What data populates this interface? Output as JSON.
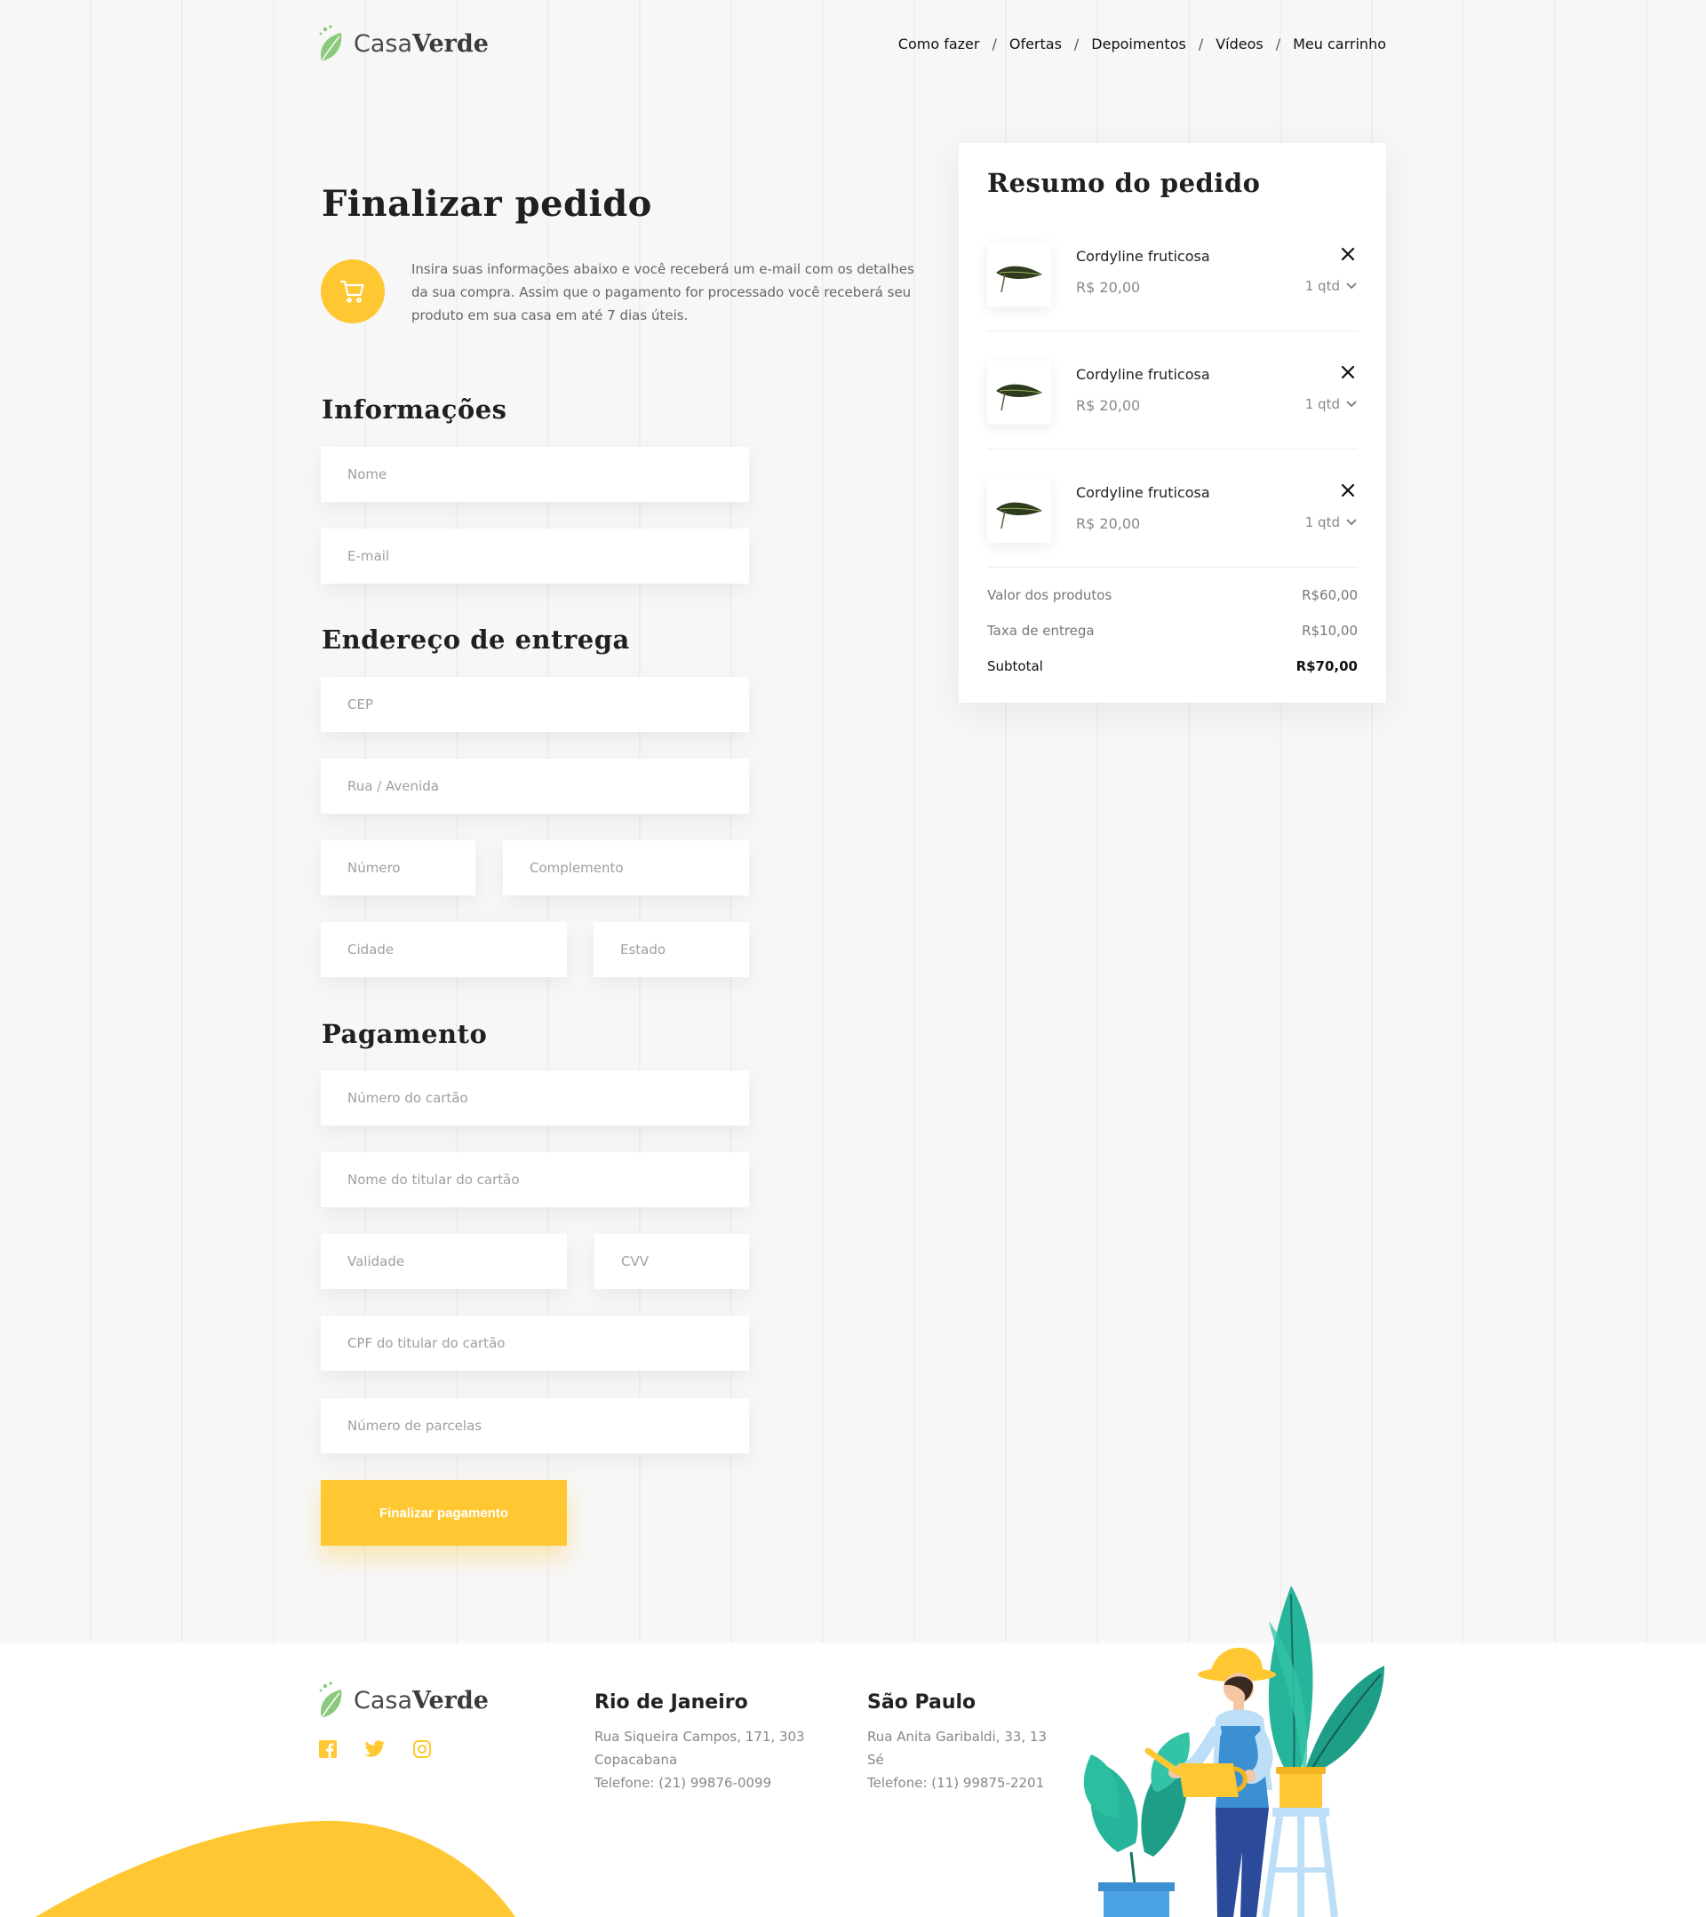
{
  "brand": {
    "name_light": "Casa",
    "name_bold": "Verde"
  },
  "nav": {
    "items": [
      "Como fazer",
      "Ofertas",
      "Depoimentos",
      "Vídeos",
      "Meu carrinho"
    ],
    "separator": "/"
  },
  "checkout": {
    "title": "Finalizar pedido",
    "intro": "Insira suas informações abaixo e você receberá um e-mail com os detalhes da sua compra. Assim que o pagamento for processado você receberá seu produto em sua casa em até 7 dias úteis.",
    "sections": {
      "info": "Informações",
      "address": "Endereço de entrega",
      "payment": "Pagamento"
    },
    "placeholders": {
      "nome": "Nome",
      "email": "E-mail",
      "cep": "CEP",
      "rua": "Rua / Avenida",
      "numero": "Número",
      "complemento": "Complemento",
      "cidade": "Cidade",
      "estado": "Estado",
      "cartao": "Número do cartão",
      "titular": "Nome do titular do cartão",
      "validade": "Validade",
      "cvv": "CVV",
      "cpf": "CPF do titular do cartão",
      "parcelas": "Número de parcelas"
    },
    "submit_label": "Finalizar pagamento"
  },
  "summary": {
    "title": "Resumo do pedido",
    "items": [
      {
        "name": "Cordyline fruticosa",
        "price": "R$ 20,00",
        "qty": "1 qtd"
      },
      {
        "name": "Cordyline fruticosa",
        "price": "R$ 20,00",
        "qty": "1 qtd"
      },
      {
        "name": "Cordyline fruticosa",
        "price": "R$ 20,00",
        "qty": "1 qtd"
      }
    ],
    "products_label": "Valor dos produtos",
    "products_value": "R$60,00",
    "shipping_label": "Taxa de entrega",
    "shipping_value": "R$10,00",
    "subtotal_label": "Subtotal",
    "subtotal_value": "R$70,00"
  },
  "footer": {
    "socials": [
      "facebook-icon",
      "twitter-icon",
      "instagram-icon"
    ],
    "offices": [
      {
        "city": "Rio de Janeiro",
        "line1": "Rua Siqueira Campos, 171, 303",
        "line2": "Copacabana",
        "phone": "Telefone: (21) 99876-0099"
      },
      {
        "city": "São Paulo",
        "line1": "Rua Anita Garibaldi, 33, 13",
        "line2": "Sé",
        "phone": "Telefone: (11) 99875-2201"
      }
    ]
  },
  "colors": {
    "accent": "#ffc732",
    "leaf": "#8bc97c",
    "dark_leaf": "#2f3b1f",
    "text": "#202020",
    "muted": "#888888"
  }
}
